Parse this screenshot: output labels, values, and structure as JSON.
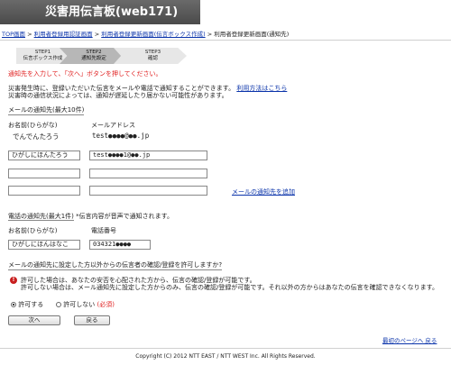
{
  "header": {
    "title": "災害用伝言板(web171)"
  },
  "breadcrumb": {
    "items": [
      "TOP画面",
      "利用者登録用認証画面",
      "利用者登録更新画面(伝言ボックス作成)"
    ],
    "current": "利用者登録更新画面(通知先)",
    "separator": ">"
  },
  "steps": [
    {
      "label": "STEP1",
      "sub": "伝言ボックス作成"
    },
    {
      "label": "STEP2",
      "sub": "通知先設定"
    },
    {
      "label": "STEP3",
      "sub": "確認"
    }
  ],
  "instruction": "通知先を入力して、「次へ」ボタンを押してください。",
  "description": {
    "line1": "災害発生時に、登録いただいた伝言をメールや電話で通知することができます。",
    "how_to_link": "利用方法はこちら",
    "line2": "災害時の通信状況によっては、通知が遅延したり届かない可能性があります。"
  },
  "mail_section": {
    "heading": "メールの通知先(最大10件)",
    "col_name": "お名前(ひらがな)",
    "col_mail": "メールアドレス",
    "registered": {
      "name": "でんでんたろう",
      "mail": "test●●●●@●●.jp"
    },
    "rows": [
      {
        "name": "ひがしにほんたろう",
        "mail": "test●●●●1@●●.jp"
      },
      {
        "name": "",
        "mail": ""
      },
      {
        "name": "",
        "mail": ""
      }
    ],
    "add_link": "メールの通知先を追加"
  },
  "phone_section": {
    "heading": "電話の通知先(最大1件)",
    "note": "*伝言内容が音声で通知されます。",
    "col_name": "お名前(ひらがな)",
    "col_phone": "電話番号",
    "row": {
      "name": "ひがしにほんはなこ",
      "phone": "034321●●●●"
    }
  },
  "permission": {
    "question": "メールの通知先に設定した方以外からの伝言者の確認/登録を許可しますか?",
    "warn_icon": "exclamation-icon",
    "line1": "許可した場合は、あなたの安否を心配された方から、伝言の確認/登録が可能です。",
    "line2": "許可しない場合は、メール通知先に設定した方からのみ、伝言の確認/登録が可能です。それ以外の方からはあなたの伝言を確認できなくなります。",
    "options": {
      "allow": "許可する",
      "deny": "許可しない",
      "required": "(必須)"
    },
    "selected": "allow"
  },
  "buttons": {
    "next": "次へ",
    "back": "戻る"
  },
  "back_to_top": "最初のページへ 戻る",
  "footer": "Copyright (C) 2012 NTT EAST / NTT WEST Inc. All Rights Reserved.",
  "colors": {
    "header_bg": "#555555",
    "link": "#0a33aa",
    "warning": "#e02020"
  }
}
